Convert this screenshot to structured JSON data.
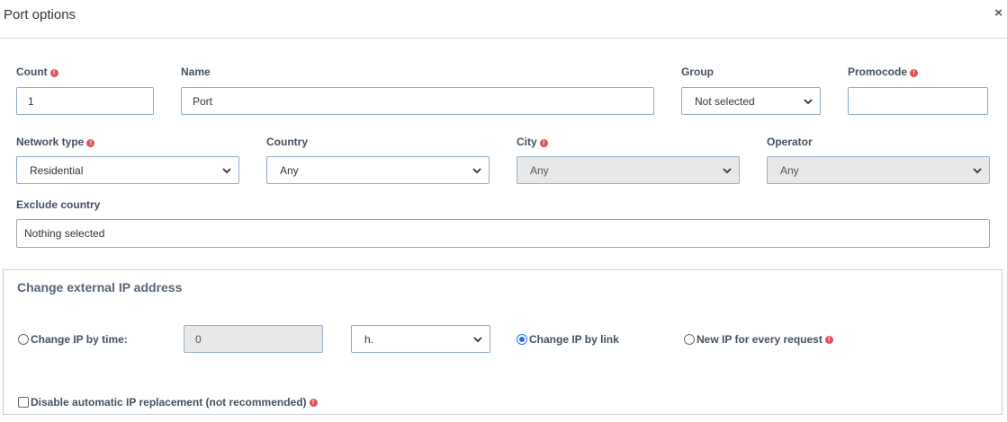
{
  "header": {
    "title": "Port options",
    "close_glyph": "×"
  },
  "fields": {
    "count": {
      "label": "Count",
      "value": "1",
      "required": true
    },
    "name": {
      "label": "Name",
      "value": "Port"
    },
    "group": {
      "label": "Group",
      "selected": "Not selected"
    },
    "promocode": {
      "label": "Promocode",
      "value": "",
      "required": true
    },
    "network_type": {
      "label": "Network type",
      "selected": "Residential",
      "required": true
    },
    "country": {
      "label": "Country",
      "selected": "Any"
    },
    "city": {
      "label": "City",
      "selected": "Any",
      "required": true,
      "disabled": true
    },
    "operator": {
      "label": "Operator",
      "selected": "Any",
      "disabled": true
    },
    "exclude_country": {
      "label": "Exclude country",
      "placeholder": "Nothing selected"
    }
  },
  "ip_section": {
    "title": "Change external IP address",
    "by_time": {
      "label": "Change IP by time:",
      "value": "0",
      "unit": "h.",
      "checked": false
    },
    "by_link": {
      "label": "Change IP by link",
      "checked": true
    },
    "every_request": {
      "label": "New IP for every request",
      "checked": false
    },
    "disable_auto": {
      "label": "Disable automatic IP replacement (not recommended)",
      "checked": false
    }
  },
  "icons": {
    "warning": "warning-icon",
    "chevron": "chevron-down-icon",
    "close": "close-icon"
  },
  "colors": {
    "field_border": "#8ea9c8",
    "disabled_bg": "#e6e8ea",
    "warning": "#e05255",
    "radio_active": "#1a73e8"
  }
}
